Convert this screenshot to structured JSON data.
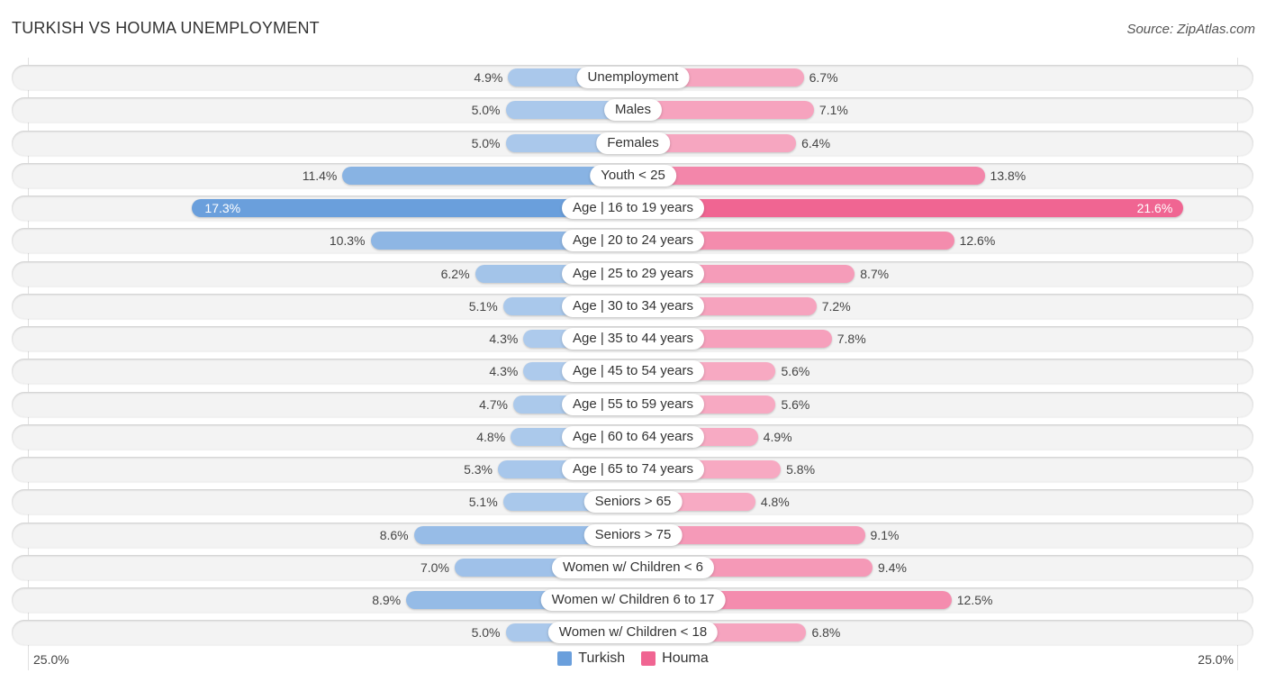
{
  "chart_data": {
    "type": "bar",
    "orientation": "horizontal-diverging",
    "title": "TURKISH VS HOUMA UNEMPLOYMENT",
    "source": "Source: ZipAtlas.com",
    "categories": [
      "Unemployment",
      "Males",
      "Females",
      "Youth < 25",
      "Age | 16 to 19 years",
      "Age | 20 to 24 years",
      "Age | 25 to 29 years",
      "Age | 30 to 34 years",
      "Age | 35 to 44 years",
      "Age | 45 to 54 years",
      "Age | 55 to 59 years",
      "Age | 60 to 64 years",
      "Age | 65 to 74 years",
      "Seniors > 65",
      "Seniors > 75",
      "Women w/ Children < 6",
      "Women w/ Children 6 to 17",
      "Women w/ Children < 18"
    ],
    "series": [
      {
        "name": "Turkish",
        "color": "#6a9fdc",
        "side": "left",
        "values": [
          4.9,
          5.0,
          5.0,
          11.4,
          17.3,
          10.3,
          6.2,
          5.1,
          4.3,
          4.3,
          4.7,
          4.8,
          5.3,
          5.1,
          8.6,
          7.0,
          8.9,
          5.0
        ]
      },
      {
        "name": "Houma",
        "color": "#f06592",
        "side": "right",
        "values": [
          6.7,
          7.1,
          6.4,
          13.8,
          21.6,
          12.6,
          8.7,
          7.2,
          7.8,
          5.6,
          5.6,
          4.9,
          5.8,
          4.8,
          9.1,
          9.4,
          12.5,
          6.8
        ]
      }
    ],
    "value_format": "{v}%",
    "axis": {
      "min_label": "25.0%",
      "max_label": "25.0%",
      "range": [
        0,
        25
      ]
    },
    "legend_position": "bottom-center",
    "grid": false
  }
}
